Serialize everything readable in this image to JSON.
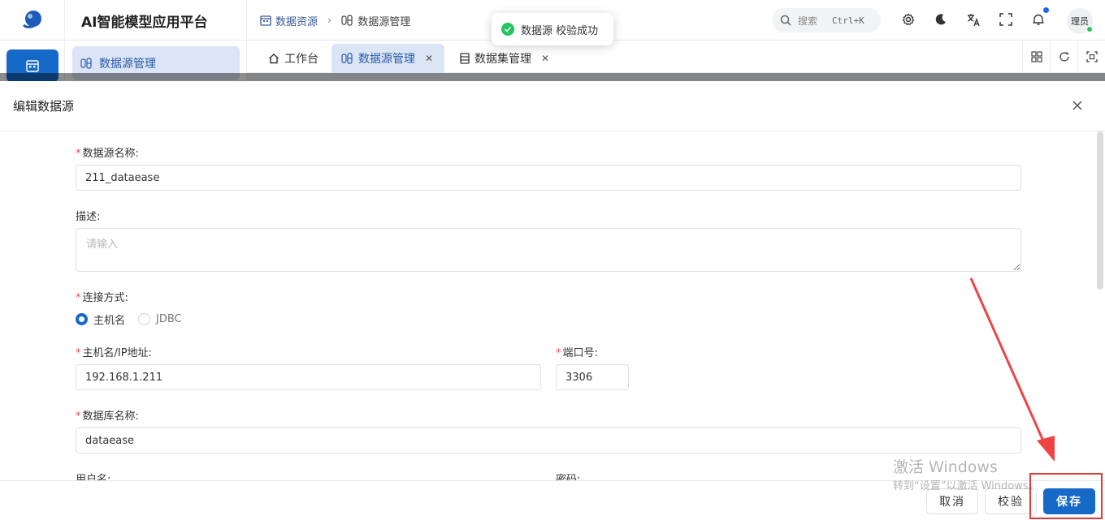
{
  "header": {
    "app_title": "AI智能模型应用平台",
    "breadcrumb": [
      "数据资源",
      "数据源管理"
    ],
    "search_placeholder": "搜索",
    "search_shortcut": "Ctrl+K",
    "avatar_text": "理员"
  },
  "sidebar": {
    "active_submenu": "数据源管理"
  },
  "tabs": [
    {
      "label": "工作台",
      "closable": false
    },
    {
      "label": "数据源管理",
      "closable": true,
      "active": true
    },
    {
      "label": "数据集管理",
      "closable": true
    }
  ],
  "toast": {
    "message": "数据源 校验成功"
  },
  "drawer": {
    "title": "编辑数据源",
    "fields": {
      "name_label": "数据源名称:",
      "name_value": "211_dataease",
      "desc_label": "描述:",
      "desc_placeholder": "请输入",
      "conn_label": "连接方式:",
      "conn_options": [
        "主机名",
        "JDBC"
      ],
      "host_label": "主机名/IP地址:",
      "host_value": "192.168.1.211",
      "port_label": "端口号:",
      "port_value": "3306",
      "db_label": "数据库名称:",
      "db_value": "dataease",
      "user_label": "用户名:",
      "pwd_label": "密码:"
    },
    "footer": {
      "cancel": "取消",
      "validate": "校验",
      "save": "保存"
    }
  },
  "watermark": {
    "line1": "激活 Windows",
    "line2": "转到“设置”以激活 Windows。"
  },
  "colors": {
    "primary": "#1769c8",
    "active_tab_bg": "#dbe5f5",
    "success": "#22c55e",
    "annotation": "#e53935"
  }
}
